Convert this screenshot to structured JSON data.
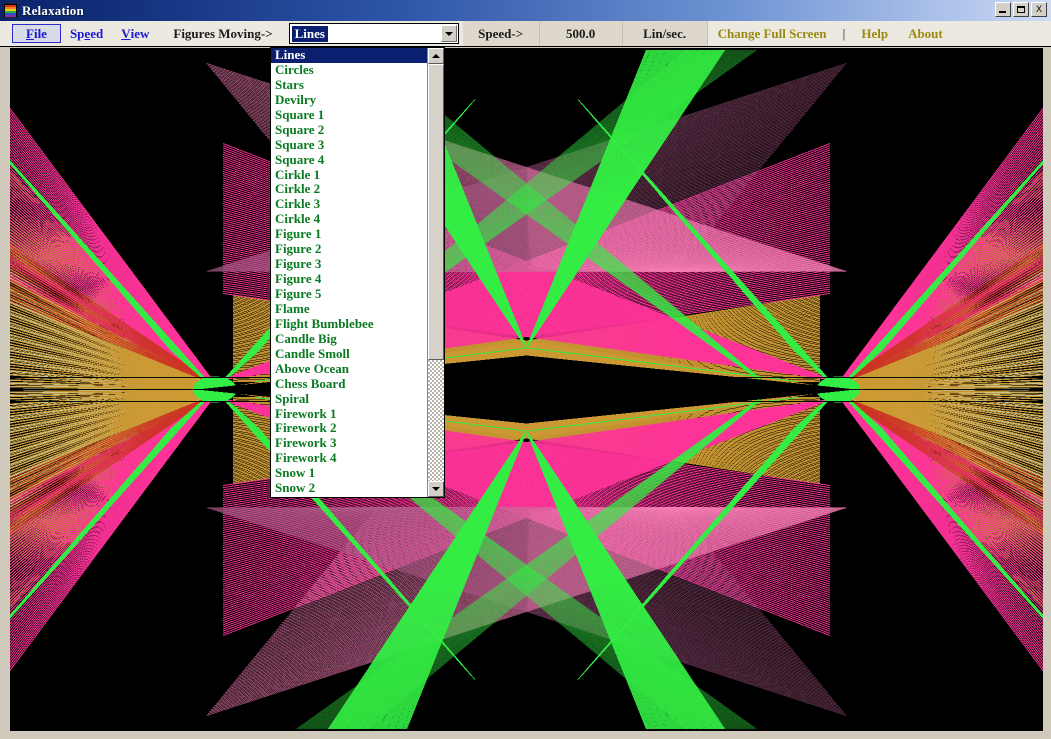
{
  "window": {
    "title": "Relaxation",
    "icon": "app-icon",
    "controls": {
      "minimize": "_",
      "maximize": "□",
      "close": "X"
    }
  },
  "toolbar": {
    "menus": [
      {
        "label": "File",
        "accel": "F",
        "name": "file"
      },
      {
        "label": "Speed",
        "accel": "e",
        "name": "speed"
      },
      {
        "label": "View",
        "accel": "V",
        "name": "view"
      }
    ],
    "figures_moving_label": "Figures Moving->",
    "combo": {
      "selected": "Lines",
      "arrow_icon": "chevron-down-icon"
    },
    "speed_label": "Speed->",
    "speed_value": "500.0",
    "speed_units": "Lin/sec.",
    "change_full_screen": "Change Full Screen",
    "separator": "|",
    "help": "Help",
    "about": "About"
  },
  "dropdown": {
    "selected_index": 0,
    "scroll_up_icon": "triangle-up-icon",
    "scroll_down_icon": "triangle-down-icon",
    "items": [
      "Lines",
      "Circles",
      "Stars",
      "Devilry",
      "Square 1",
      "Square 2",
      "Square 3",
      "Square 4",
      "Cirkle 1",
      "Cirkle 2",
      "Cirkle 3",
      "Cirkle 4",
      "Figure 1",
      "Figure 2",
      "Figure 3",
      "Figure 4",
      "Figure 5",
      "Flame",
      "Flight Bumblebee",
      "Candle Big",
      "Candle Smoll",
      "Above Ocean",
      "Chess Board",
      "Spiral",
      "Firework 1",
      "Firework 2",
      "Firework 3",
      "Firework 4",
      "Snow 1",
      "Snow 2"
    ]
  },
  "colors": {
    "title_bar_start": "#0a246a",
    "title_bar_end": "#b3c7ec",
    "menu_link": "#1a1ad0",
    "accent_link": "#9a8a12",
    "list_item": "#0a7a22",
    "selection": "#0a1f70",
    "canvas_background": "#000000",
    "art_magenta": "#ff3399",
    "art_pink": "#f77fb5",
    "art_green": "#33ee44",
    "art_khaki": "#d9d9a0",
    "art_tan": "#cc9933",
    "art_red": "#cc3322",
    "art_plum": "#b05a8a"
  },
  "artwork": {
    "description": "Lines figure: symmetric line-fan moire pattern on black canvas",
    "mode": "Lines"
  }
}
